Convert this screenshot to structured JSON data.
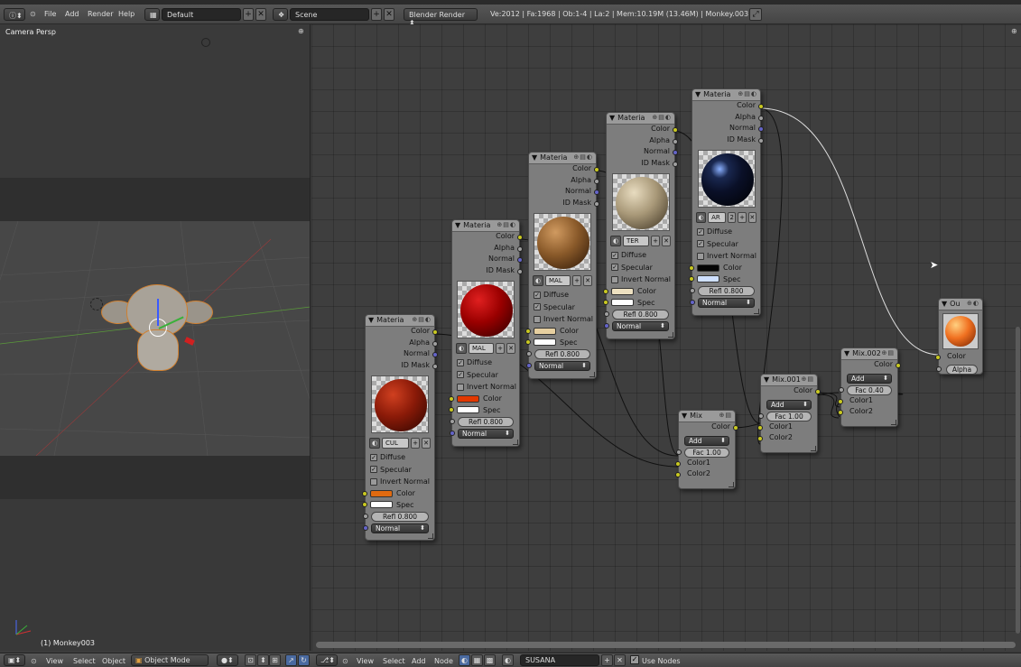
{
  "topbar": {
    "menus": [
      "File",
      "Add",
      "Render",
      "Help"
    ],
    "screen_layout": "Default",
    "scene": "Scene",
    "render_engine": "Blender Render",
    "stats": "Ve:2012 | Fa:1968 | Ob:1-4 | La:2 | Mem:10.19M (13.46M) | Monkey.003"
  },
  "viewport": {
    "label": "Camera Persp",
    "object_label": "(1) Monkey003"
  },
  "nodes": {
    "materials": [
      {
        "title": "Materia",
        "outputs": [
          "Color",
          "Alpha",
          "Normal",
          "ID Mask"
        ],
        "sphere_color": "#8a1a08",
        "mat_name": "CUL",
        "diffuse": "Diffuse",
        "specular": "Specular",
        "invert": "Invert Normal",
        "color_label": "Color",
        "color_swatch": "#e06a10",
        "spec_label": "Spec",
        "spec_swatch": "#ffffff",
        "refl": "Refl 0.800",
        "normal": "Normal"
      },
      {
        "title": "Materia",
        "outputs": [
          "Color",
          "Alpha",
          "Normal",
          "ID Mask"
        ],
        "sphere_color": "#9a0000",
        "mat_name": "MAL",
        "diffuse": "Diffuse",
        "specular": "Specular",
        "invert": "Invert Normal",
        "color_label": "Color",
        "color_swatch": "#e23800",
        "spec_label": "Spec",
        "spec_swatch": "#ffffff",
        "refl": "Refl 0.800",
        "normal": "Normal"
      },
      {
        "title": "Materia",
        "outputs": [
          "Color",
          "Alpha",
          "Normal",
          "ID Mask"
        ],
        "sphere_color": "#8a5a2a",
        "mat_name": "MAL",
        "diffuse": "Diffuse",
        "specular": "Specular",
        "invert": "Invert Normal",
        "color_label": "Color",
        "color_swatch": "#e6cfa0",
        "spec_label": "Spec",
        "spec_swatch": "#ffffff",
        "refl": "Refl 0.800",
        "normal": "Normal"
      },
      {
        "title": "Materia",
        "outputs": [
          "Color",
          "Alpha",
          "Normal",
          "ID Mask"
        ],
        "sphere_color": "#a89878",
        "mat_name": "TER",
        "diffuse": "Diffuse",
        "specular": "Specular",
        "invert": "Invert Normal",
        "color_label": "Color",
        "color_swatch": "#ede0c0",
        "spec_label": "Spec",
        "spec_swatch": "#ffffff",
        "refl": "Refl 0.800",
        "normal": "Normal"
      },
      {
        "title": "Materia",
        "outputs": [
          "Color",
          "Alpha",
          "Normal",
          "ID Mask"
        ],
        "sphere_color": "#0a1028",
        "mat_name": "AR",
        "mat_users": "2",
        "diffuse": "Diffuse",
        "specular": "Specular",
        "invert": "Invert Normal",
        "color_label": "Color",
        "color_swatch": "#050505",
        "spec_label": "Spec",
        "spec_swatch": "#cfe0ff",
        "refl": "Refl 0.800",
        "normal": "Normal"
      }
    ],
    "mix": {
      "title": "Mix",
      "output": "Color",
      "blend": "Add",
      "fac": "Fac 1.00",
      "in1": "Color1",
      "in2": "Color2"
    },
    "mix001": {
      "title": "Mix.001",
      "output": "Color",
      "blend": "Add",
      "fac": "Fac 1.00",
      "in1": "Color1",
      "in2": "Color2"
    },
    "mix002": {
      "title": "Mix.002",
      "output": "Color",
      "blend": "Add",
      "fac": "Fac 0.40",
      "in1": "Color1",
      "in2": "Color2"
    },
    "output": {
      "title": "Ou",
      "in_color": "Color",
      "in_alpha": "Alpha"
    }
  },
  "bottombar": {
    "left_menus": [
      "View",
      "Select",
      "Object"
    ],
    "mode": "Object Mode",
    "right_menus": [
      "View",
      "Select",
      "Add",
      "Node"
    ],
    "material_name": "SUSANA",
    "use_nodes": "Use Nodes"
  }
}
